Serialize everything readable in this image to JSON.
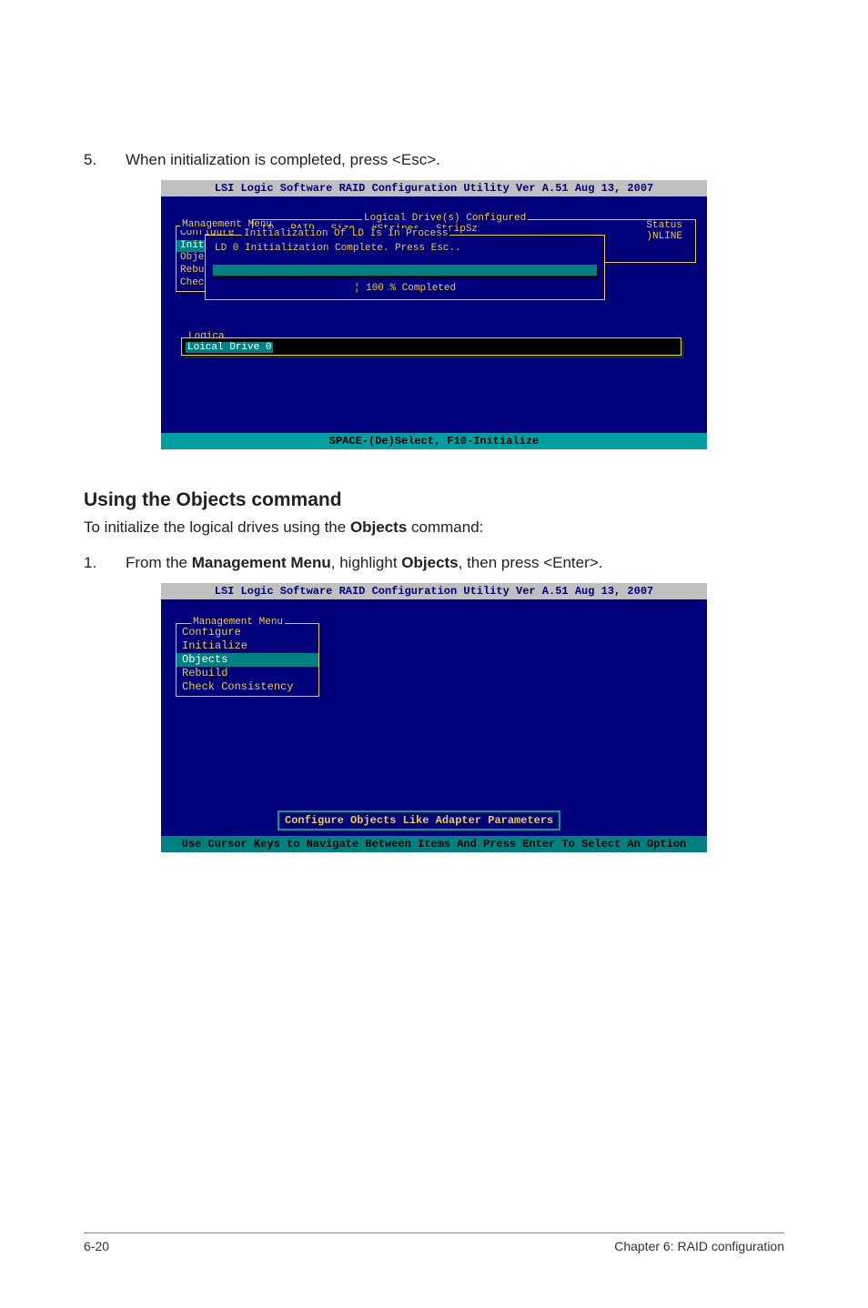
{
  "step5": {
    "num": "5.",
    "text_before": "When initialization is completed, press ",
    "key": "<Esc>",
    "text_after": "."
  },
  "term1": {
    "title": "LSI Logic Software RAID Configuration Utility Ver A.51 Aug 13, 2007",
    "menu_title": "Management Menu",
    "menu": {
      "items": [
        "Configure",
        "Initiali",
        "Objects",
        "Rebuild",
        "Check Co"
      ],
      "selected": 1
    },
    "logic_title": "Logical Drive(s) Configured",
    "logic_headers": [
      "LD",
      "RAID",
      "Size",
      "#Stripes",
      "StripSz"
    ],
    "status_header": "Status",
    "status_value": ")NLINE",
    "init_title": "Initialization Of LD Is In Process",
    "init_msg": "LD 0 Initialization Complete. Press Esc..",
    "progress_label": "¦ 100 % Completed",
    "logica_label": "Logica",
    "ld_row": "Loical Drive 0",
    "footer": "SPACE-(De)Select, F10-Initialize"
  },
  "section_heading": "Using the Objects command",
  "para_before": "To initialize the logical drives using the ",
  "para_bold": "Objects",
  "para_after": " command:",
  "step1": {
    "num": "1.",
    "t1": "From the ",
    "b1": "Management Menu",
    "t2": ", highlight ",
    "b2": "Objects",
    "t3": ", then press ",
    "key": "<Enter>",
    "t4": "."
  },
  "term2": {
    "title": "LSI Logic Software RAID Configuration Utility Ver A.51 Aug 13, 2007",
    "menu_title": "Management Menu",
    "menu": {
      "items": [
        "Configure",
        "Initialize",
        "Objects",
        "Rebuild",
        "Check Consistency"
      ],
      "selected": 2
    },
    "hint": "Configure Objects Like Adapter Parameters",
    "footer": "Use Cursor Keys to Navigate Between Items And Press Enter To Select An Option"
  },
  "footer": {
    "left": "6-20",
    "right": "Chapter 6: RAID configuration"
  }
}
